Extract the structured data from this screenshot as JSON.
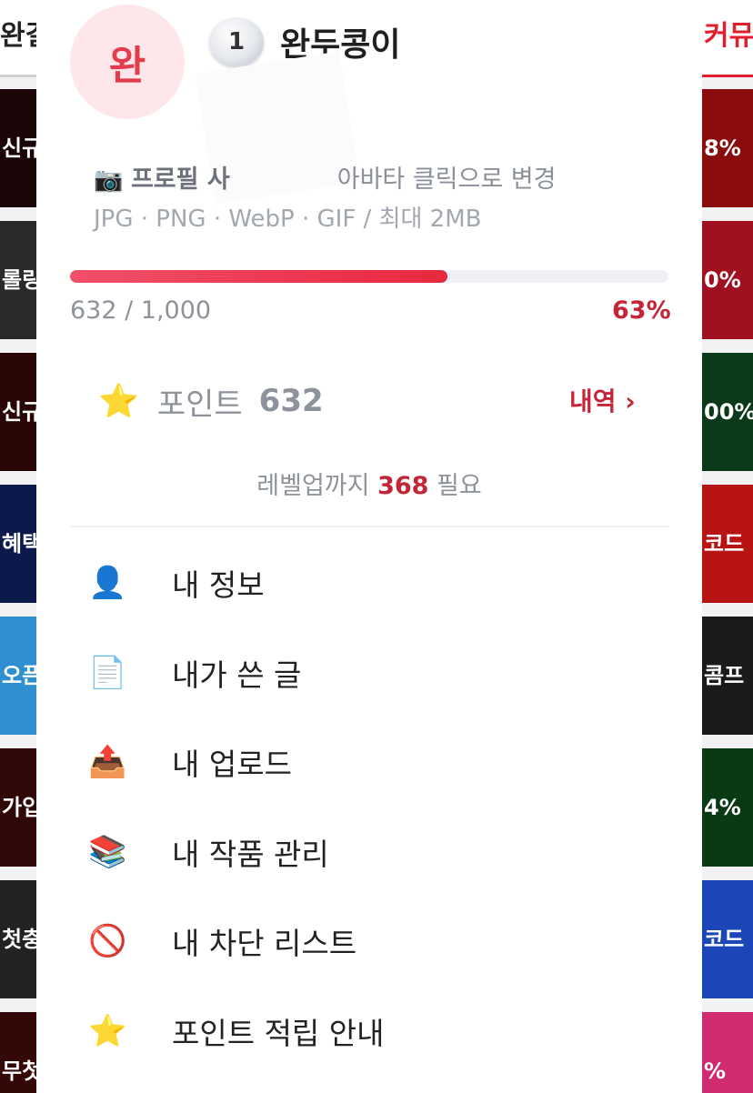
{
  "colors": {
    "accent": "#c42637",
    "progress_fill": "#e8283f",
    "progress_track": "#eef0f5",
    "avatar_bg": "#fde7ea",
    "avatar_text": "#e33c4d"
  },
  "background": {
    "left_header": "완결",
    "right_header": "커뮤",
    "left_banners": [
      "신규첫",
      "롤링",
      "신규첫",
      "혜택",
      "오픈",
      "가입",
      "첫충",
      "무첫"
    ],
    "right_banners": [
      "8%",
      "0%",
      "00%",
      "코드",
      "콤프",
      "4%",
      "코드",
      "%"
    ]
  },
  "profile": {
    "avatar_initial": "완",
    "level": "1",
    "nickname": "완두콩이",
    "avatar_hint_icon": "📷",
    "avatar_hint_bold": "프로필 사",
    "avatar_hint_rest": "아바타 클릭으로 변경",
    "file_hint": "JPG · PNG · WebP · GIF / 최대 2MB"
  },
  "exp": {
    "current_label": "632 / 1,000",
    "percent_label": "63%",
    "fill_fraction": 0.63
  },
  "points": {
    "icon": "⭐",
    "label": "포인트",
    "value": "632",
    "history_link": "내역 ›",
    "levelup_prefix": "레벨업까지 ",
    "levelup_value": "368",
    "levelup_suffix": " 필요"
  },
  "menu": [
    {
      "icon": "👤",
      "icon_name": "user-icon",
      "label": "내 정보"
    },
    {
      "icon": "📄",
      "icon_name": "document-icon",
      "label": "내가 쓴 글"
    },
    {
      "icon": "📤",
      "icon_name": "upload-tray-icon",
      "label": "내 업로드"
    },
    {
      "icon": "📚",
      "icon_name": "books-icon",
      "label": "내 작품 관리"
    },
    {
      "icon": "🚫",
      "icon_name": "block-icon",
      "label": "내 차단 리스트"
    },
    {
      "icon": "⭐",
      "icon_name": "star-icon",
      "label": "포인트 적립 안내"
    }
  ]
}
